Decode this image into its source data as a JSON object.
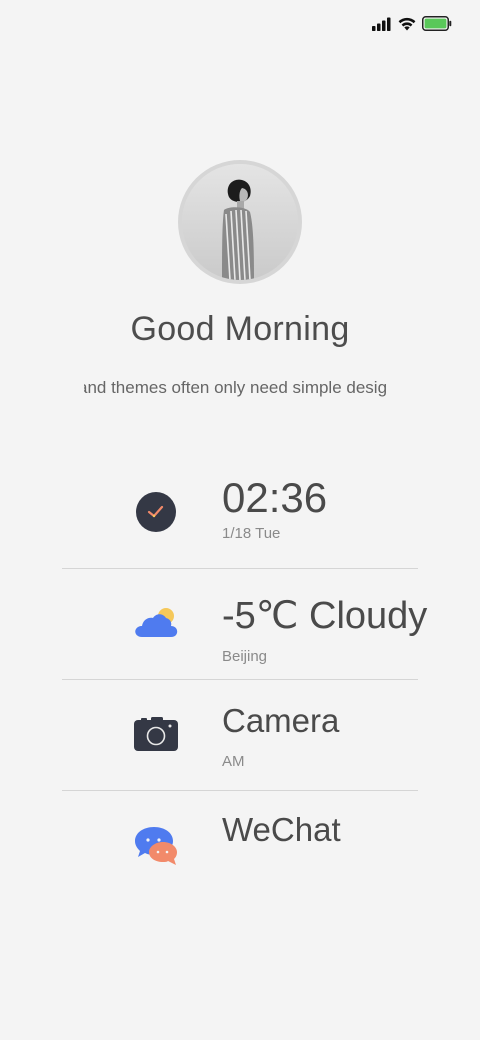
{
  "status_bar": {
    "signal_icon": "cellular-signal-icon",
    "wifi_icon": "wifi-icon",
    "battery_icon": "battery-icon",
    "battery_color": "#5ac85a"
  },
  "profile": {
    "greeting": "Good Morning",
    "tagline": "and themes often only need simple desig"
  },
  "items": [
    {
      "icon": "clock-icon",
      "title": "02:36",
      "sub": "1/18 Tue"
    },
    {
      "icon": "cloudy-weather-icon",
      "title": "-5℃ Cloudy",
      "sub": "Beijing"
    },
    {
      "icon": "camera-icon",
      "title": "Camera",
      "sub": "AM"
    },
    {
      "icon": "wechat-icon",
      "title": "WeChat",
      "sub": ""
    }
  ],
  "colors": {
    "background": "#f4f4f4",
    "text": "#4a4a4a",
    "divider": "#d5d5d5",
    "icon_dark": "#343845",
    "icon_blue": "#4f7bef",
    "icon_yellow": "#f5c85a",
    "icon_orange": "#f28a6a"
  }
}
